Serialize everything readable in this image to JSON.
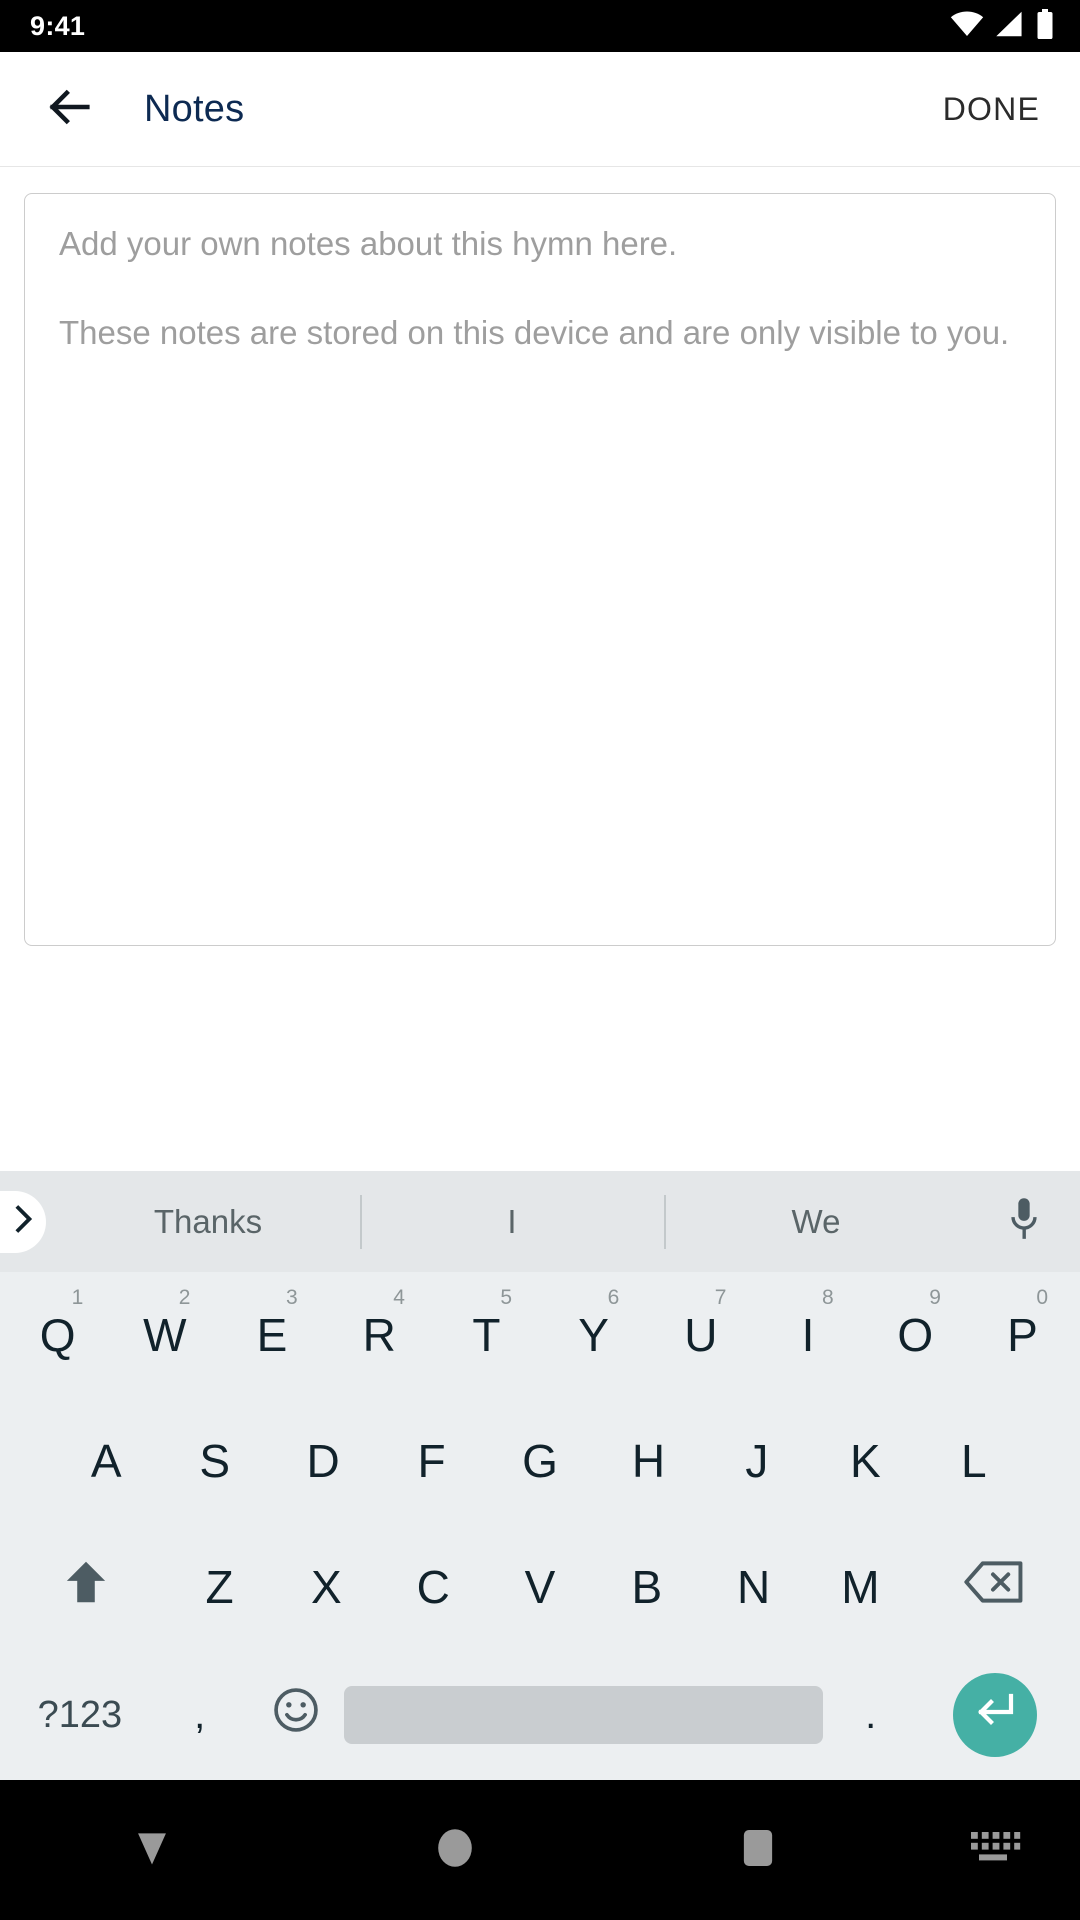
{
  "status_bar": {
    "time": "9:41",
    "icons": [
      "wifi-icon",
      "cellular-signal-icon",
      "battery-icon"
    ]
  },
  "app_bar": {
    "back_icon": "arrow-left-icon",
    "title": "Notes",
    "done_label": "DONE",
    "title_color": "#0d2a52"
  },
  "notes": {
    "placeholder_line_1": "Add your own notes about this hymn here.",
    "placeholder_line_2": "These notes are stored on this device and are only visible to you.",
    "value": ""
  },
  "keyboard": {
    "suggestions": [
      "Thanks",
      "I",
      "We"
    ],
    "expand_icon": "chevron-right-icon",
    "mic_icon": "microphone-icon",
    "row1": [
      {
        "label": "Q",
        "hint": "1"
      },
      {
        "label": "W",
        "hint": "2"
      },
      {
        "label": "E",
        "hint": "3"
      },
      {
        "label": "R",
        "hint": "4"
      },
      {
        "label": "T",
        "hint": "5"
      },
      {
        "label": "Y",
        "hint": "6"
      },
      {
        "label": "U",
        "hint": "7"
      },
      {
        "label": "I",
        "hint": "8"
      },
      {
        "label": "O",
        "hint": "9"
      },
      {
        "label": "P",
        "hint": "0"
      }
    ],
    "row2": [
      "A",
      "S",
      "D",
      "F",
      "G",
      "H",
      "J",
      "K",
      "L"
    ],
    "row3": [
      "Z",
      "X",
      "C",
      "V",
      "B",
      "N",
      "M"
    ],
    "shift_icon": "shift-arrow-up-icon",
    "backspace_icon": "backspace-icon",
    "symbols_label": "?123",
    "comma_label": ",",
    "emoji_icon": "emoji-smiley-icon",
    "space_label": "",
    "period_label": ".",
    "enter_icon": "enter-return-icon",
    "enter_color": "#45b0a5"
  },
  "nav_bar": {
    "back_icon": "triangle-down-dismiss-icon",
    "home_icon": "circle-home-icon",
    "recents_icon": "square-recents-icon",
    "switch_keyboard_icon": "keyboard-icon"
  }
}
